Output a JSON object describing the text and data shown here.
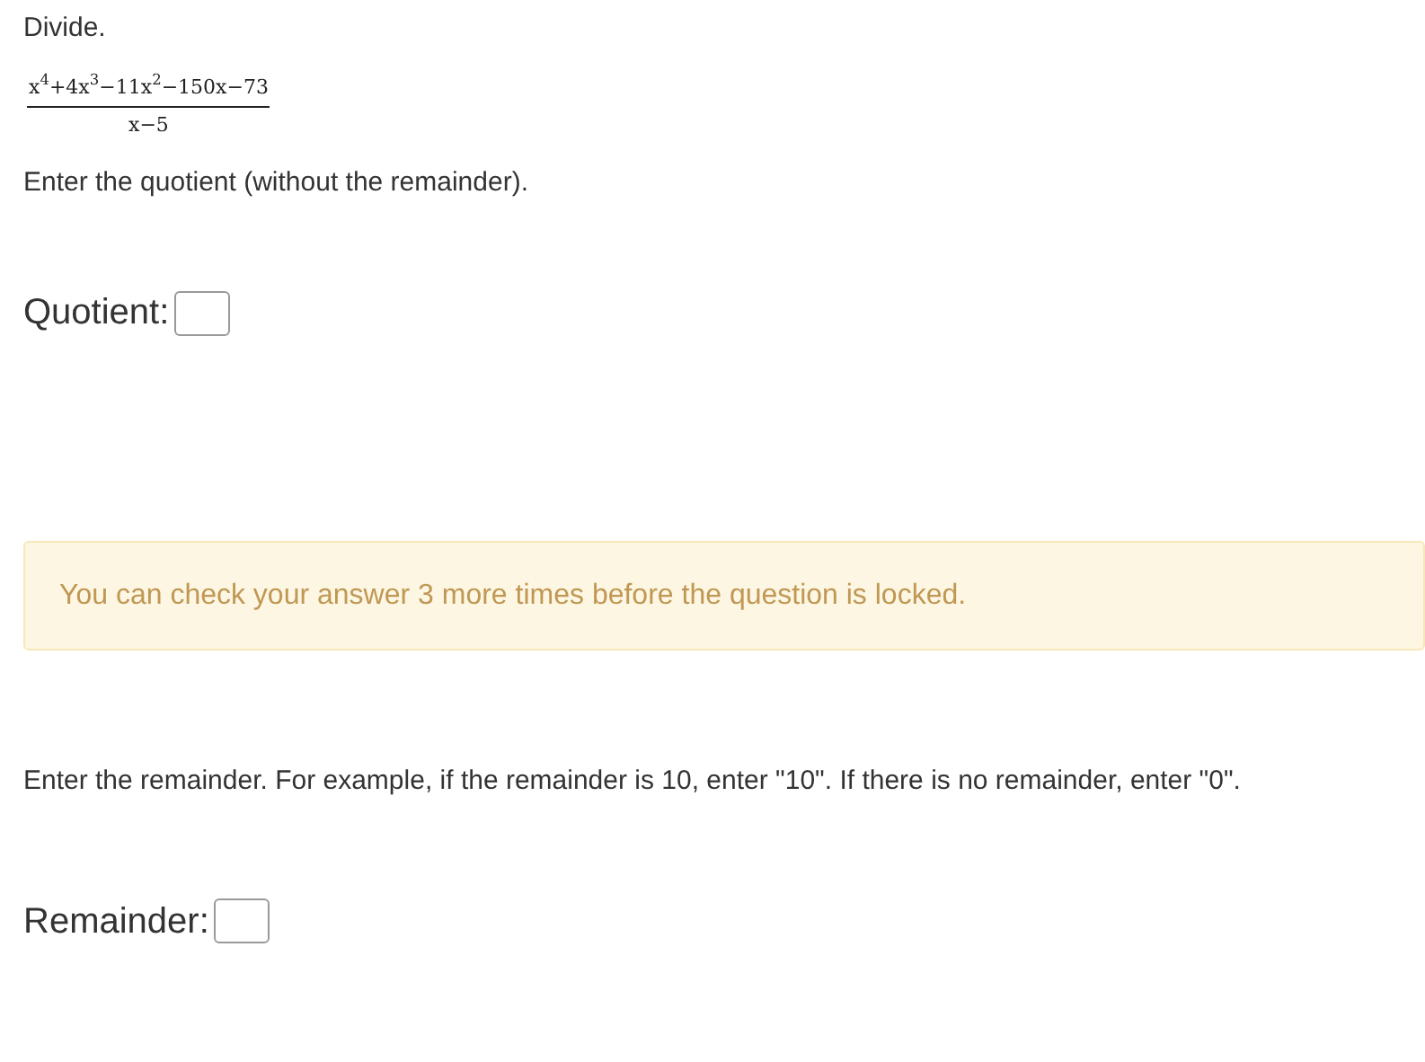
{
  "instruction": "Divide.",
  "fraction": {
    "numerator": "x$^{4}$+4x$^{3}$−11x$^{2}$−150x−73",
    "denominator": "x−5"
  },
  "prompt_quotient": "Enter the quotient (without the remainder).",
  "quotient_field": {
    "label": "Quotient:"
  },
  "alert": "You can check your answer 3 more times before the question is locked.",
  "prompt_remainder": "Enter the remainder. For example, if the remainder is 10, enter \"10\". If there is no remainder, enter \"0\".",
  "remainder_field": {
    "label": "Remainder:"
  }
}
